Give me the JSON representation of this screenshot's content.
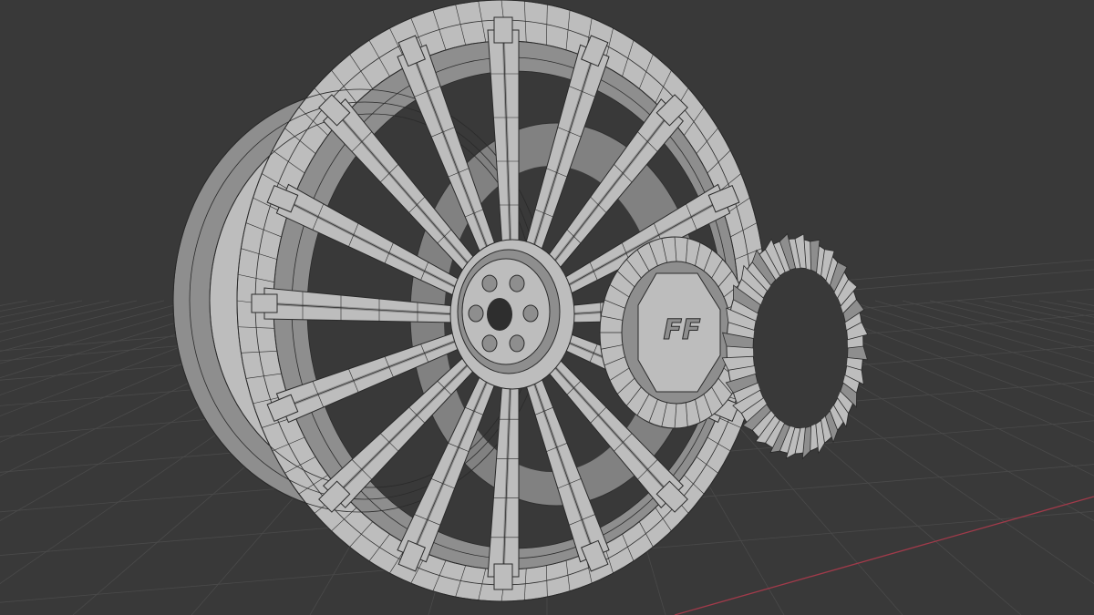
{
  "viewport": {
    "background": "#393939",
    "grid_color": "#4a4a4a",
    "x_axis_color": "#a13a4a",
    "y_axis_color": "#6b8e2a",
    "model_fill": "#bdbdbd",
    "model_shade": "#8e8e8e",
    "wire_color": "#2a2a2a",
    "emblem_text": "FF",
    "overlays": "none"
  },
  "model": {
    "name": "wheel-rim",
    "spoke_count": 16,
    "lug_count": 6,
    "parts": [
      "rim",
      "spokes",
      "hub",
      "center-cap",
      "brake-rotor"
    ]
  }
}
